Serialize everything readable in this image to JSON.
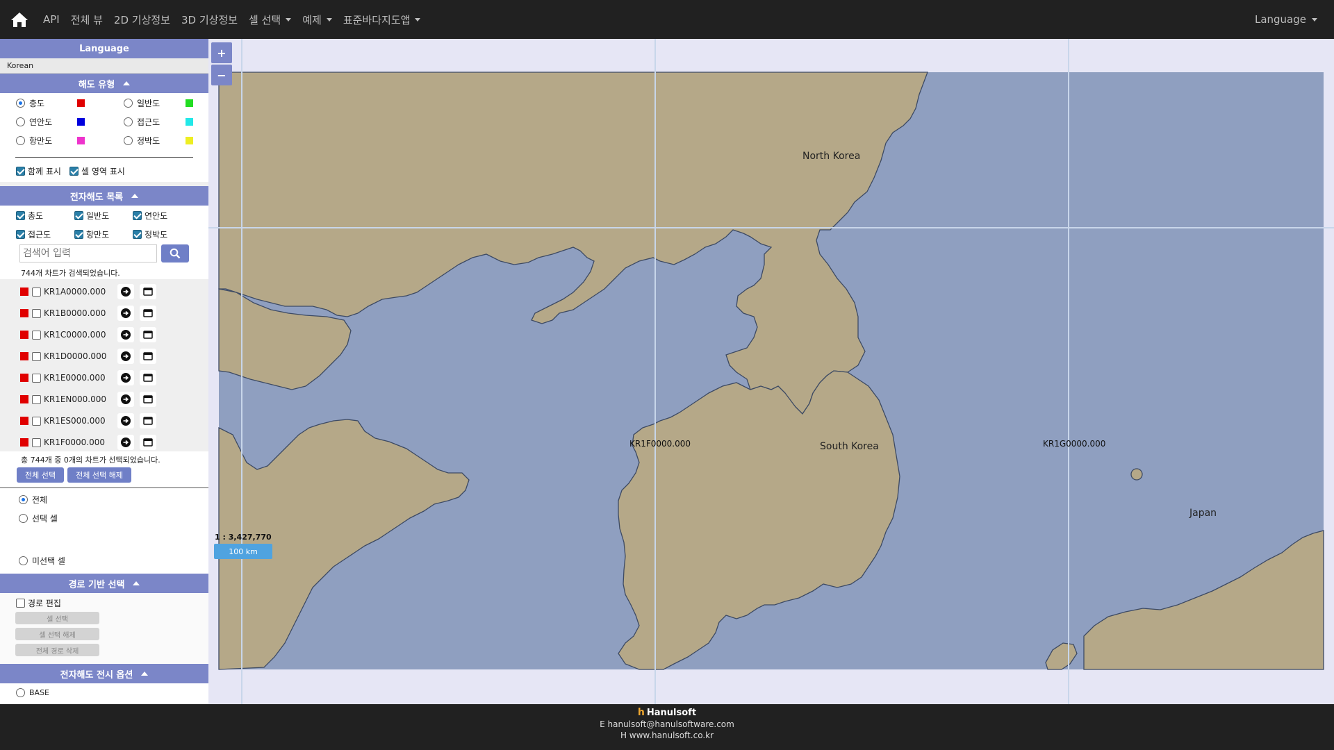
{
  "nav": {
    "items": [
      {
        "label": "API",
        "dropdown": false
      },
      {
        "label": "전체 뷰",
        "dropdown": false
      },
      {
        "label": "2D 기상정보",
        "dropdown": false
      },
      {
        "label": "3D 기상정보",
        "dropdown": false
      },
      {
        "label": "셀 선택",
        "dropdown": true
      },
      {
        "label": "예제",
        "dropdown": true
      },
      {
        "label": "표준바다지도앱",
        "dropdown": true
      }
    ],
    "language_label": "Language"
  },
  "sidebar": {
    "language": {
      "title": "Language",
      "value": "Korean"
    },
    "chart_type": {
      "title": "해도 유형",
      "options": [
        {
          "label": "총도",
          "color": "#e00000",
          "selected": true
        },
        {
          "label": "일반도",
          "color": "#22dd22",
          "selected": false
        },
        {
          "label": "연안도",
          "color": "#0000dd",
          "selected": false
        },
        {
          "label": "접근도",
          "color": "#22e8e8",
          "selected": false
        },
        {
          "label": "항만도",
          "color": "#ee33cc",
          "selected": false
        },
        {
          "label": "정박도",
          "color": "#eeee22",
          "selected": false
        }
      ],
      "show_together": "함께 표시",
      "show_cell_area": "셀 영역 표시"
    },
    "enc_list": {
      "title": "전자해도 목록",
      "filters": [
        "총도",
        "일반도",
        "연안도",
        "접근도",
        "항만도",
        "정박도"
      ],
      "search_placeholder": "검색어 입력",
      "result_text": "744개 차트가 검색되었습니다.",
      "charts": [
        "KR1A0000.000",
        "KR1B0000.000",
        "KR1C0000.000",
        "KR1D0000.000",
        "KR1E0000.000",
        "KR1EN000.000",
        "KR1ES000.000",
        "KR1F0000.000"
      ],
      "selected_text": "총 744개 중 0개의 차트가 선택되었습니다.",
      "select_all": "전체 선택",
      "deselect_all": "전체 선택 해제",
      "cell_filter": [
        "전체",
        "선택 셀",
        "미선택 셀"
      ]
    },
    "route": {
      "title": "경로 기반 선택",
      "edit_label": "경로 편집",
      "buttons": [
        "셀 선택",
        "셀 선택 해제",
        "전체 경로 삭제"
      ]
    },
    "display": {
      "title": "전자해도 전시 옵션",
      "base_label": "BASE"
    }
  },
  "map": {
    "zoom_in": "+",
    "zoom_out": "−",
    "scale_text": "1 : 3,427,770",
    "scale_bar": "100 km",
    "cells": [
      "KR1F0000.000",
      "KR1G0000.000"
    ],
    "countries": [
      "North Korea",
      "South Korea",
      "Japan"
    ],
    "land_color": "#b5a888",
    "sea_color": "#8f9fc0"
  },
  "footer": {
    "brand": "Hanulsoft",
    "email": "E hanulsoft@hanulsoftware.com",
    "website": "H www.hanulsoft.co.kr"
  }
}
